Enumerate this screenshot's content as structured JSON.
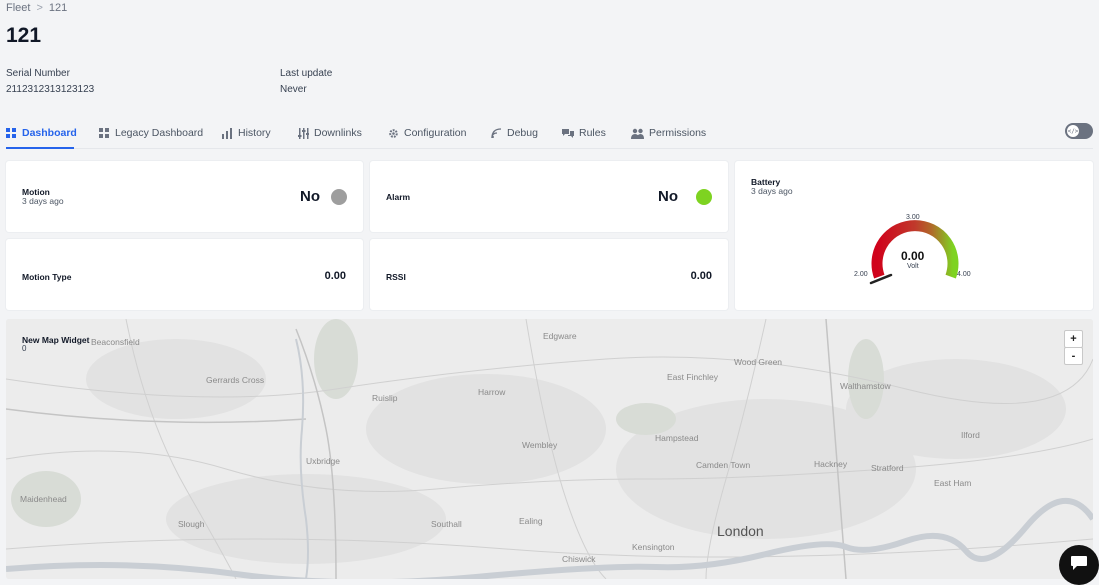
{
  "breadcrumb": {
    "parent": "Fleet",
    "separator": ">",
    "current": "121"
  },
  "page": {
    "title": "121"
  },
  "meta": {
    "serial_label": "Serial Number",
    "serial_value": "2112312313123123",
    "update_label": "Last update",
    "update_value": "Never"
  },
  "tabs": [
    {
      "label": "Dashboard",
      "icon": "grid-icon",
      "active": true
    },
    {
      "label": "Legacy Dashboard",
      "icon": "grid-icon"
    },
    {
      "label": "History",
      "icon": "bar-chart-icon"
    },
    {
      "label": "Downlinks",
      "icon": "sliders-icon"
    },
    {
      "label": "Configuration",
      "icon": "gear-icon"
    },
    {
      "label": "Debug",
      "icon": "signal-icon"
    },
    {
      "label": "Rules",
      "icon": "chat-icon"
    },
    {
      "label": "Permissions",
      "icon": "users-icon"
    }
  ],
  "dev_toggle": {
    "icon": "code-icon",
    "state": "off"
  },
  "widgets": {
    "motion": {
      "title": "Motion",
      "sub": "3 days ago",
      "value": "No",
      "indicator_color": "#9e9e9e"
    },
    "alarm": {
      "title": "Alarm",
      "value": "No",
      "indicator_color": "#7ed321"
    },
    "motion_type": {
      "title": "Motion Type",
      "value": "0.00"
    },
    "rssi": {
      "title": "RSSI",
      "value": "0.00"
    },
    "battery": {
      "title": "Battery",
      "sub": "3 days ago",
      "value": "0.00",
      "unit": "Volt",
      "min": "2.00",
      "mid": "3.00",
      "max": "4.00",
      "level": 0
    }
  },
  "map": {
    "title": "New Map Widget",
    "sub": "0",
    "zoom_in": "+",
    "zoom_out": "-",
    "places": [
      "Beaconsfield",
      "Edgware",
      "Wood Green",
      "East Finchley",
      "Walthamstow",
      "Gerrards Cross",
      "Ruislip",
      "Harrow",
      "Wembley",
      "Hampstead",
      "Ilford",
      "Uxbridge",
      "Camden Town",
      "Hackney",
      "Stratford",
      "East Ham",
      "Maidenhead",
      "Slough",
      "Southall",
      "Ealing",
      "London",
      "Kensington",
      "Chiswick"
    ]
  },
  "colors": {
    "accent": "#2563eb",
    "gauge_low": "#d0021b",
    "gauge_high": "#7ed321"
  }
}
